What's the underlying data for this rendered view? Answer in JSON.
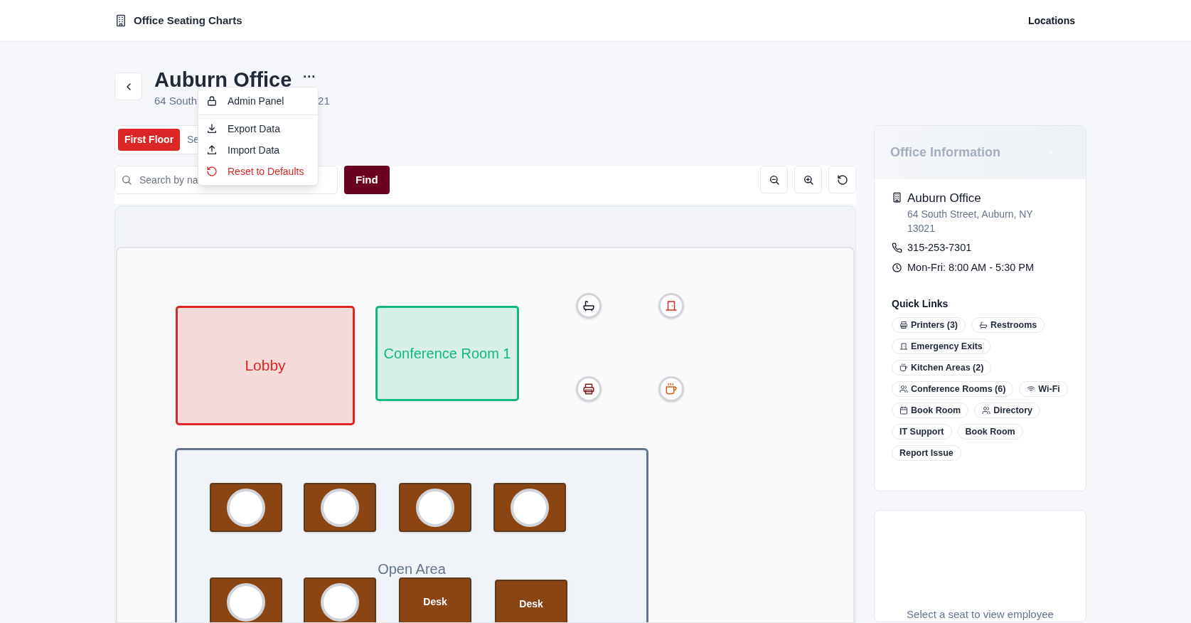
{
  "header": {
    "title": "Office Seating Charts",
    "nav": "Locations"
  },
  "office": {
    "title": "Auburn Office",
    "more": "···",
    "address_start": "64 South",
    "address_end": "21"
  },
  "menu": {
    "items": [
      {
        "kind": "lock",
        "label": "Admin Panel",
        "danger": false,
        "divider_after": true
      },
      {
        "kind": "download",
        "label": "Export Data",
        "danger": false,
        "divider_after": false
      },
      {
        "kind": "upload",
        "label": "Import Data",
        "danger": false,
        "divider_after": false
      },
      {
        "kind": "reset",
        "label": "Reset to Defaults",
        "danger": true,
        "divider_after": false
      }
    ]
  },
  "floor_tabs": [
    {
      "label": "First Floor",
      "selected": true
    },
    {
      "label": "Se",
      "selected": false
    }
  ],
  "search": {
    "placeholder": "Search by na",
    "button": "Find"
  },
  "floor_plan": {
    "rooms": [
      {
        "name": "Lobby",
        "color": "#dc2626"
      },
      {
        "name": "Conference Room 1",
        "color": "#10b981"
      }
    ],
    "amenities": [
      {
        "kind": "bath"
      },
      {
        "kind": "door"
      },
      {
        "kind": "printer"
      },
      {
        "kind": "cup"
      }
    ],
    "area": {
      "name": "Open Area",
      "desks": [
        {
          "kind": "seat"
        },
        {
          "kind": "seat"
        },
        {
          "kind": "seat"
        },
        {
          "kind": "seat"
        },
        {
          "kind": "seat"
        },
        {
          "kind": "seat"
        },
        {
          "kind": "label",
          "label": "Desk"
        },
        {
          "kind": "label",
          "label": "Desk"
        }
      ]
    }
  },
  "office_info": {
    "heading": "Office Information",
    "name": "Auburn Office",
    "address": "64 South Street, Auburn, NY 13021",
    "phone": "315-253-7301",
    "hours": "Mon-Fri: 8:00 AM - 5:30 PM",
    "quick_links_title": "Quick Links",
    "quick_links": [
      {
        "kind": "printer",
        "label": "Printers (3)"
      },
      {
        "kind": "bath",
        "label": "Restrooms"
      },
      {
        "kind": "door",
        "label": "Emergency Exits"
      },
      {
        "kind": "cup",
        "label": "Kitchen Areas (2)"
      },
      {
        "kind": "people",
        "label": "Conference Rooms (6)"
      },
      {
        "kind": "wifi",
        "label": "Wi-Fi"
      },
      {
        "kind": "calendar",
        "label": "Book Room"
      },
      {
        "kind": "people",
        "label": "Directory"
      },
      {
        "kind": "plain",
        "label": "IT Support"
      },
      {
        "kind": "plain",
        "label": "Book Room"
      },
      {
        "kind": "plain",
        "label": "Report Issue"
      }
    ]
  },
  "employee_panel": {
    "hint": "Select a seat to view employee"
  }
}
